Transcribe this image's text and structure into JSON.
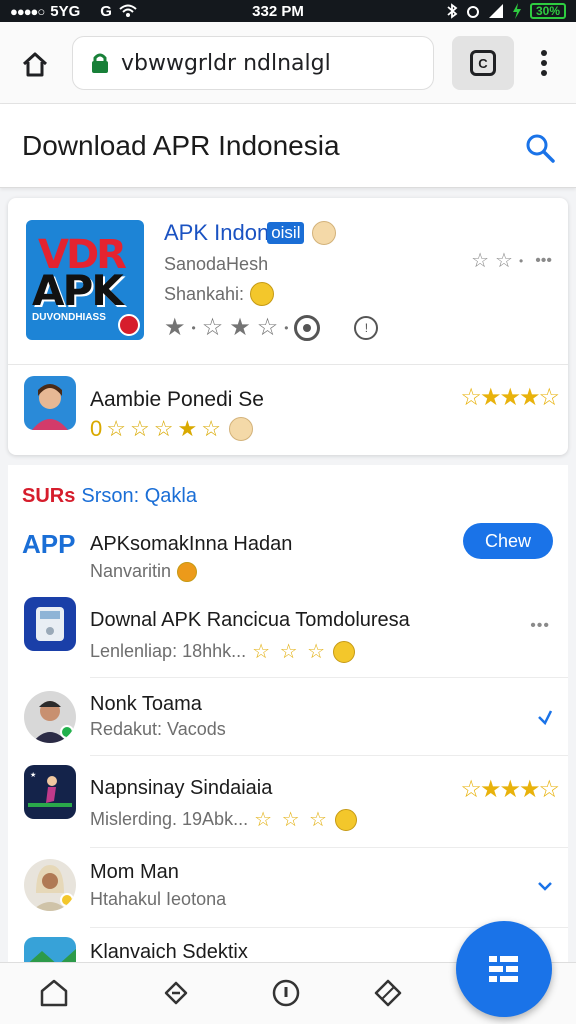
{
  "status_bar": {
    "carrier": "5YG",
    "network_icon": "G",
    "time": "332 PM",
    "battery": "30%"
  },
  "browser": {
    "url": "vbwwgrldr ndlnalgl",
    "tabs_label": "C"
  },
  "header": {
    "title": "Download APR Indonesia"
  },
  "featured": {
    "icon_text_top": "VDR",
    "icon_text_main": "APK",
    "icon_text_bottom": "DUVONDHIASS",
    "name": "APK Indon",
    "name_tag": "oisil",
    "developer": "SanodaHesh",
    "subtitle": "Shankahi:",
    "right_dots": "•••"
  },
  "second_item": {
    "name": "Aambie Ponedi Se",
    "rating_prefix": "0"
  },
  "section": {
    "label_red": "SURs",
    "label_blue": "Srson: Qakla"
  },
  "list": {
    "app_label": "APP",
    "rows": [
      {
        "title": "APKsomakInna Hadan",
        "subtitle": "Nanvaritin",
        "action": "Chew"
      },
      {
        "title": "Downal APK Rancicua Tomdoluresa",
        "subtitle": "Lenlenliap: 18hhk...",
        "more": "•••"
      },
      {
        "title": "Nonk Toama",
        "subtitle": "Redakut: Vacods"
      },
      {
        "title": "Napnsinay Sindaiaia",
        "subtitle": "Mislerding. 19Abk..."
      },
      {
        "title": "Mom Man",
        "subtitle": "Htahakul Ieotona"
      },
      {
        "title": "Klanvaich Sdektix"
      }
    ]
  },
  "colors": {
    "accent": "#1a73e8",
    "brand_red": "#d61d2c",
    "star_gold": "#e3b010"
  }
}
